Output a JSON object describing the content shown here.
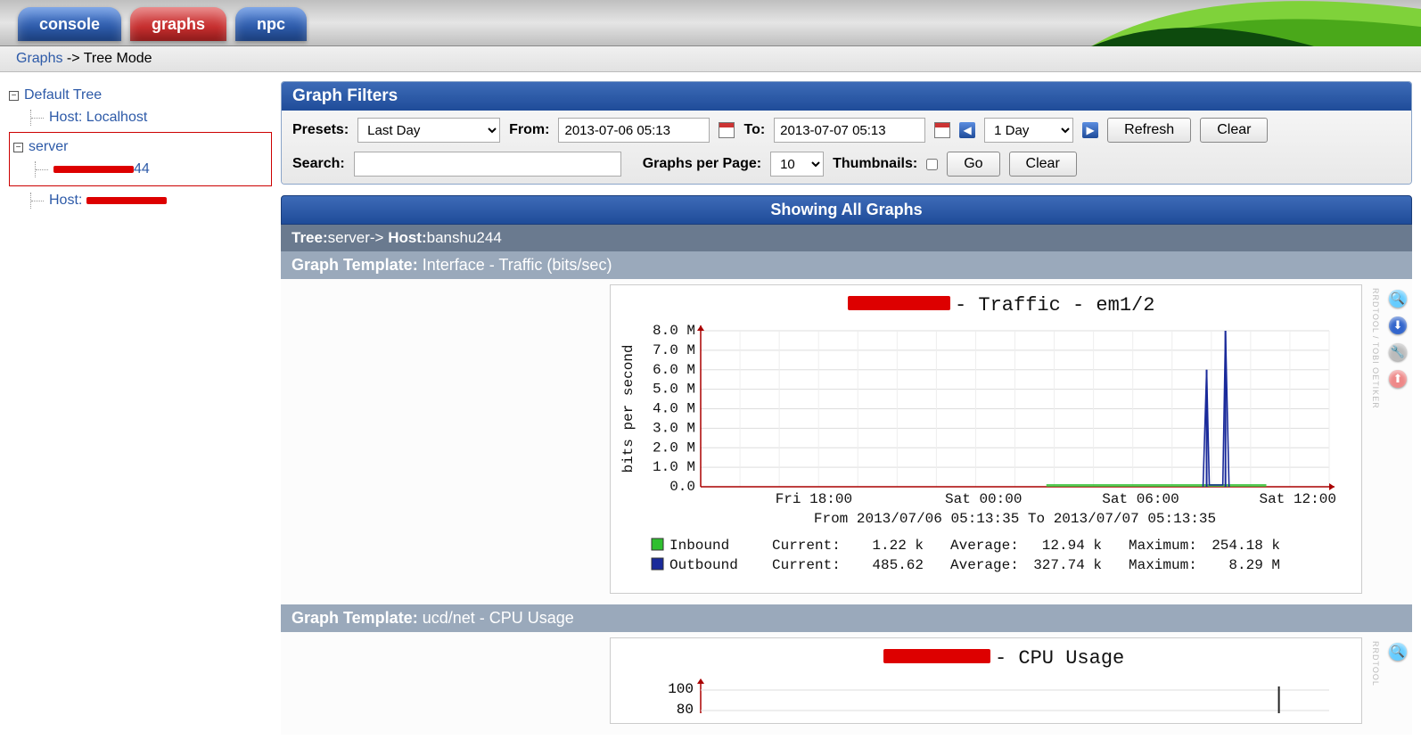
{
  "tabs": {
    "console": "console",
    "graphs": "graphs",
    "npc": "npc"
  },
  "breadcrumb": {
    "graphs": "Graphs",
    "sep": " -> ",
    "mode": "Tree Mode"
  },
  "tree": {
    "default_tree": "Default Tree",
    "host_localhost": "Host: Localhost",
    "server": "server",
    "host_redacted1_prefix": "Host: ",
    "host_redacted1_suffix": "44",
    "host_redacted2_prefix": "Host: "
  },
  "filters": {
    "title": "Graph Filters",
    "presets_label": "Presets:",
    "presets_value": "Last Day",
    "from_label": "From:",
    "from_value": "2013-07-06 05:13",
    "to_label": "To:",
    "to_value": "2013-07-07 05:13",
    "span_value": "1 Day",
    "refresh": "Refresh",
    "clear": "Clear",
    "search_label": "Search:",
    "search_value": "",
    "gpp_label": "Graphs per Page:",
    "gpp_value": "10",
    "thumbnails_label": "Thumbnails:",
    "go": "Go",
    "clear2": "Clear"
  },
  "section": {
    "showing": "Showing All Graphs",
    "path_tree_label": "Tree:",
    "path_tree": "server",
    "path_sep": "-> ",
    "path_host_label": "Host:",
    "path_host": "banshu244",
    "template1_label": "Graph Template: ",
    "template1": "Interface - Traffic (bits/sec)",
    "template2_label": "Graph Template: ",
    "template2": "ucd/net - CPU Usage"
  },
  "chart_data": [
    {
      "type": "line",
      "title": " - Traffic - em1/2",
      "ylabel": "bits per second",
      "ylim": [
        0,
        8000000
      ],
      "y_ticks": [
        "0.0",
        "1.0 M",
        "2.0 M",
        "3.0 M",
        "4.0 M",
        "5.0 M",
        "6.0 M",
        "7.0 M",
        "8.0 M"
      ],
      "x_ticks": [
        "Fri 18:00",
        "Sat 00:00",
        "Sat 06:00",
        "Sat 12:00"
      ],
      "subtitle": "From 2013/07/06 05:13:35 To 2013/07/07 05:13:35",
      "series": [
        {
          "name": "Inbound",
          "color": "#2fbf2f",
          "legend": {
            "Current:": "1.22 k",
            "Average:": "12.94 k",
            "Maximum:": "254.18 k"
          }
        },
        {
          "name": "Outbound",
          "color": "#1a2a9a",
          "legend": {
            "Current:": "485.62",
            "Average:": "327.74 k",
            "Maximum:": "8.29 M"
          }
        }
      ],
      "outbound_spikes": [
        {
          "x_frac": 0.805,
          "y": 6000000
        },
        {
          "x_frac": 0.835,
          "y": 8300000
        }
      ]
    },
    {
      "type": "line",
      "title": " - CPU Usage",
      "y_ticks": [
        "80",
        "100"
      ],
      "ylim": [
        0,
        100
      ]
    }
  ],
  "rrd_credit": "RRDTOOL / TOBI OETIKER"
}
